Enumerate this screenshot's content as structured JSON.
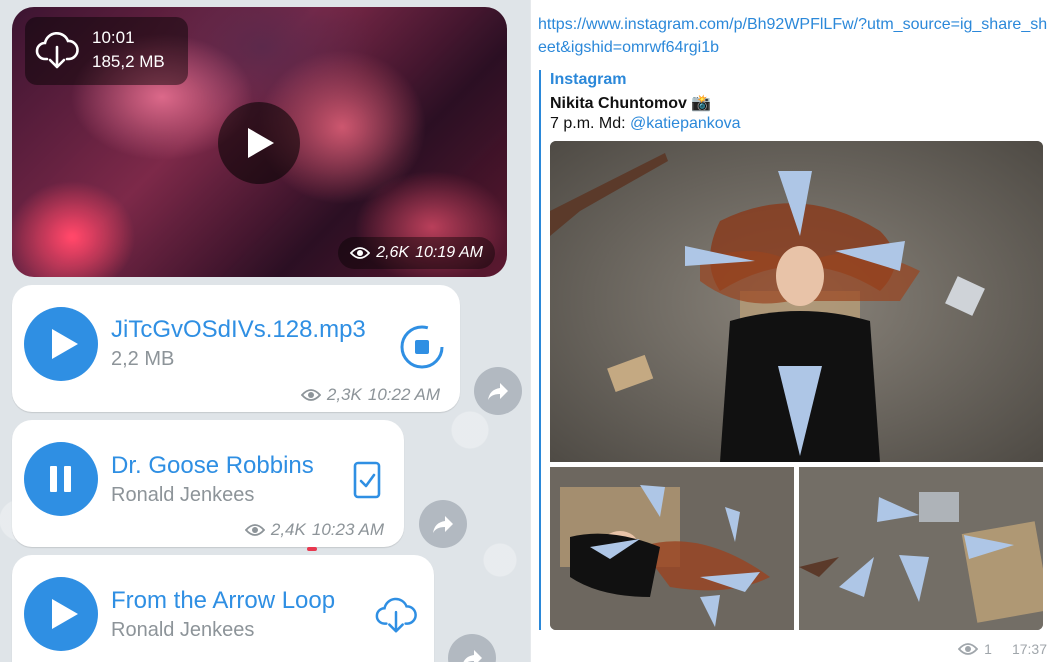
{
  "video": {
    "time": "10:01",
    "size": "185,2 MB",
    "views": "2,6K",
    "timestamp": "10:19 AM"
  },
  "audio_messages": [
    {
      "title": "JiTcGvOSdIVs.128.mp3",
      "subtitle": "2,2 MB",
      "views": "2,3K",
      "timestamp": "10:22 AM",
      "state": "play",
      "side_icon": "stop-icon"
    },
    {
      "title": "Dr. Goose Robbins",
      "subtitle": "Ronald Jenkees",
      "views": "2,4K",
      "timestamp": "10:23 AM",
      "state": "pause",
      "side_icon": "phone-check-icon"
    },
    {
      "title": "From the Arrow Loop",
      "subtitle": "Ronald Jenkees",
      "views": "",
      "timestamp": "",
      "state": "play",
      "side_icon": "cloud-download-icon"
    }
  ],
  "post": {
    "link": "https://www.instagram.com/p/Bh92WPFlLFw/?utm_source=ig_share_sheet&igshid=omrwf64rgi1b",
    "site_name": "Instagram",
    "title": "Nikita Chuntomov 📸",
    "desc_prefix": "7 p.m. Md: ",
    "mention": "@katiepankova",
    "views": "1",
    "time": "17:37"
  },
  "colors": {
    "accent": "#2f8fe3",
    "link": "#2b88d9",
    "meta": "#8d9499"
  }
}
